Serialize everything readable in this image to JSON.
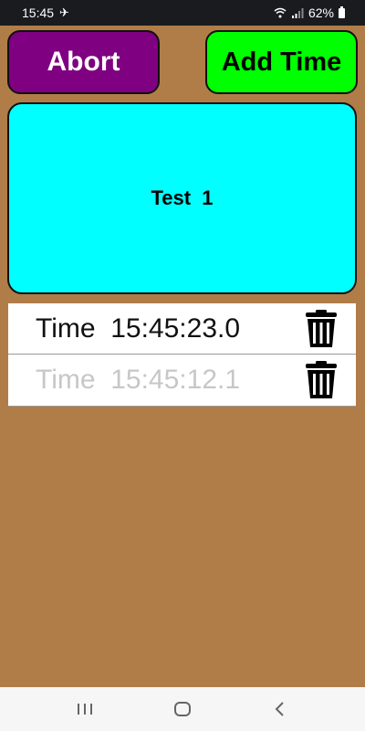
{
  "status_bar": {
    "time": "15:45",
    "battery_percent": "62%",
    "icons": [
      "airplane-mode-icon",
      "wifi-icon",
      "signal-icon",
      "battery-icon"
    ]
  },
  "buttons": {
    "abort_label": "Abort",
    "add_time_label": "Add Time"
  },
  "test_card": {
    "label": "Test  1"
  },
  "times": [
    {
      "label": "Time  15:45:23.0",
      "active": true
    },
    {
      "label": "Time  15:45:12.1",
      "active": false
    }
  ],
  "colors": {
    "background": "#b07d48",
    "abort": "#7f0080",
    "add_time": "#00ff00",
    "test_card": "#00ffff",
    "inactive_text": "#c7c7c7"
  },
  "nav_bar": {
    "icons": [
      "recent-apps-icon",
      "home-icon",
      "back-icon"
    ]
  }
}
